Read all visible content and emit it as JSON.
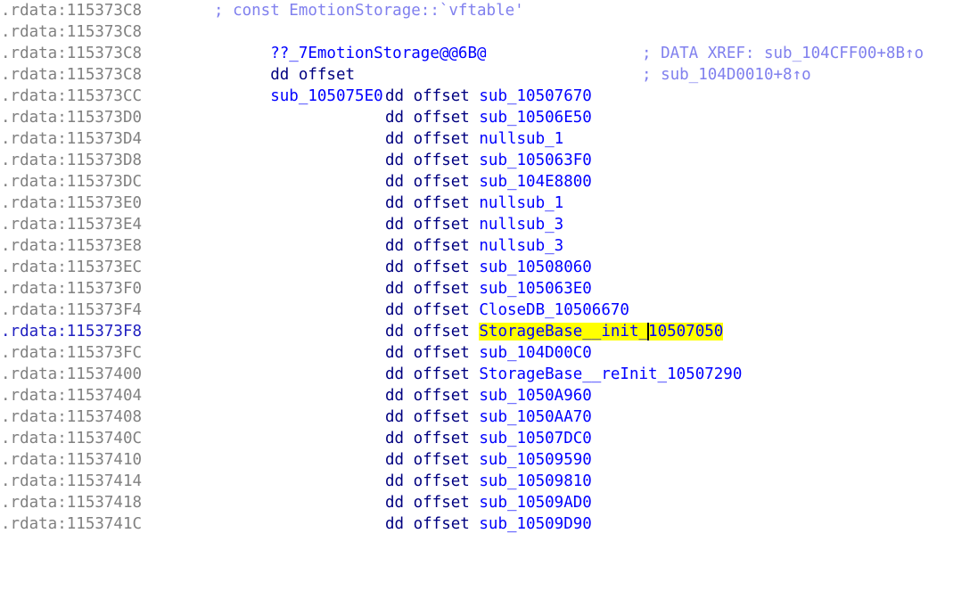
{
  "header": {
    "address": ".rdata:115373C8",
    "vftable_comment": "; const EmotionStorage::`vftable'",
    "label_name": "??_7EmotionStorage@@6B@",
    "label_directive": "dd offset",
    "label_target": "sub_105075E0",
    "xref_1": "; DATA XREF: sub_104CFF00+8B↑o",
    "xref_2": "; sub_104D0010+8↑o"
  },
  "directive": "dd offset",
  "rows": [
    {
      "address": ".rdata:115373CC",
      "target": "sub_10507670"
    },
    {
      "address": ".rdata:115373D0",
      "target": "sub_10506E50"
    },
    {
      "address": ".rdata:115373D4",
      "target": "nullsub_1"
    },
    {
      "address": ".rdata:115373D8",
      "target": "sub_105063F0"
    },
    {
      "address": ".rdata:115373DC",
      "target": "sub_104E8800"
    },
    {
      "address": ".rdata:115373E0",
      "target": "nullsub_1"
    },
    {
      "address": ".rdata:115373E4",
      "target": "nullsub_3"
    },
    {
      "address": ".rdata:115373E8",
      "target": "nullsub_3"
    },
    {
      "address": ".rdata:115373EC",
      "target": "sub_10508060"
    },
    {
      "address": ".rdata:115373F0",
      "target": "sub_105063E0"
    },
    {
      "address": ".rdata:115373F4",
      "target": "CloseDB_10506670"
    },
    {
      "address": ".rdata:115373F8",
      "target_before_cursor": "StorageBase__init_",
      "target_after_cursor": "10507050",
      "current": true
    },
    {
      "address": ".rdata:115373FC",
      "target": "sub_104D00C0"
    },
    {
      "address": ".rdata:11537400",
      "target": "StorageBase__reInit_10507290"
    },
    {
      "address": ".rdata:11537404",
      "target": "sub_1050A960"
    },
    {
      "address": ".rdata:11537408",
      "target": "sub_1050AA70"
    },
    {
      "address": ".rdata:1153740C",
      "target": "sub_10507DC0"
    },
    {
      "address": ".rdata:11537410",
      "target": "sub_10509590"
    },
    {
      "address": ".rdata:11537414",
      "target": "sub_10509810"
    },
    {
      "address": ".rdata:11537418",
      "target": "sub_10509AD0"
    },
    {
      "address": ".rdata:1153741C",
      "target": "sub_10509D90"
    }
  ],
  "colors": {
    "address": "#808080",
    "current_address": "#2020c0",
    "comment": "#8080ee",
    "directive": "#000080",
    "reference": "#0000ff",
    "highlight": "#ffff00"
  }
}
